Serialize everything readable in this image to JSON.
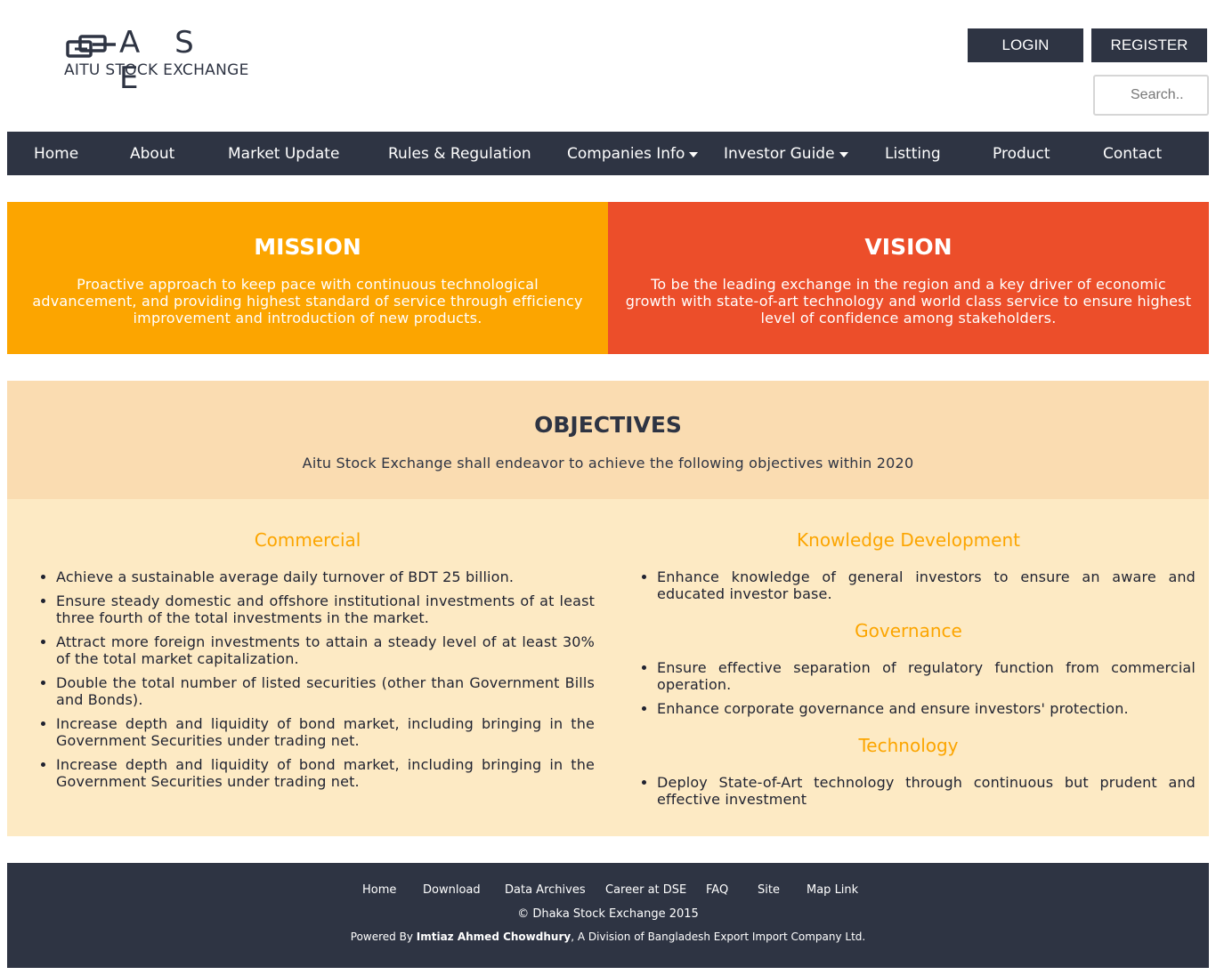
{
  "brand": {
    "letters": "A S E",
    "tagline": "AITU STOCK EXCHANGE"
  },
  "auth": {
    "login": "LOGIN",
    "register": "REGISTER"
  },
  "search": {
    "placeholder": "Search.."
  },
  "nav": [
    {
      "label": "Home"
    },
    {
      "label": "About"
    },
    {
      "label": "Market Update"
    },
    {
      "label": "Rules & Regulation"
    },
    {
      "label": "Companies Info",
      "dropdown": true
    },
    {
      "label": "Investor Guide",
      "dropdown": true
    },
    {
      "label": "Listting"
    },
    {
      "label": "Product"
    },
    {
      "label": "Contact"
    }
  ],
  "mission": {
    "title": "MISSION",
    "text": "Proactive approach to keep pace with continuous technological advancement, and providing highest standard of service through efficiency improvement and introduction of new products."
  },
  "vision": {
    "title": "VISION",
    "text": "To be the leading exchange in the region and a key driver of economic growth with state-of-art technology and world class service to ensure highest level of confidence among stakeholders."
  },
  "objectives": {
    "title": "OBJECTIVES",
    "subtitle": "Aitu Stock Exchange shall endeavor to achieve the following objectives within 2020",
    "commercial": {
      "title": "Commercial",
      "items": [
        "Achieve a sustainable average daily turnover of BDT 25 billion.",
        "Ensure steady domestic and offshore institutional investments of at least three fourth of the total investments in the market.",
        "Attract more foreign investments to attain a steady level of at least 30% of the total market capitalization.",
        "Double the total number of listed securities (other than Government Bills and Bonds).",
        "Increase depth and liquidity of bond market, including bringing in the Government Securities under trading net.",
        "Increase depth and liquidity of bond market, including bringing in the Government Securities under trading net."
      ]
    },
    "knowledge": {
      "title": "Knowledge Development",
      "items": [
        "Enhance knowledge of general investors to ensure an aware and educated investor base."
      ]
    },
    "governance": {
      "title": "Governance",
      "items": [
        "Ensure effective separation of regulatory function from commercial operation.",
        "Enhance corporate governance and ensure investors' protection."
      ]
    },
    "technology": {
      "title": "Technology",
      "items": [
        "Deploy State-of-Art technology through continuous but prudent and effective investment"
      ]
    }
  },
  "footer": {
    "links": [
      "Home",
      "Download",
      "Data Archives",
      "Career at DSE",
      "FAQ",
      "Site",
      "Map Link"
    ],
    "copyright": "© Dhaka Stock Exchange 2015",
    "powered_prefix": "Powered By ",
    "powered_name": "Imtiaz Ahmed Chowdhury",
    "powered_suffix": ", A Division of Bangladesh Export Import Company Ltd."
  },
  "colors": {
    "dark": "#2e3443",
    "mission": "#fca500",
    "vision": "#ec4e2a",
    "objectives_head": "#fadcb1",
    "objectives_body": "#fdeac4",
    "section_title": "#fca500"
  }
}
